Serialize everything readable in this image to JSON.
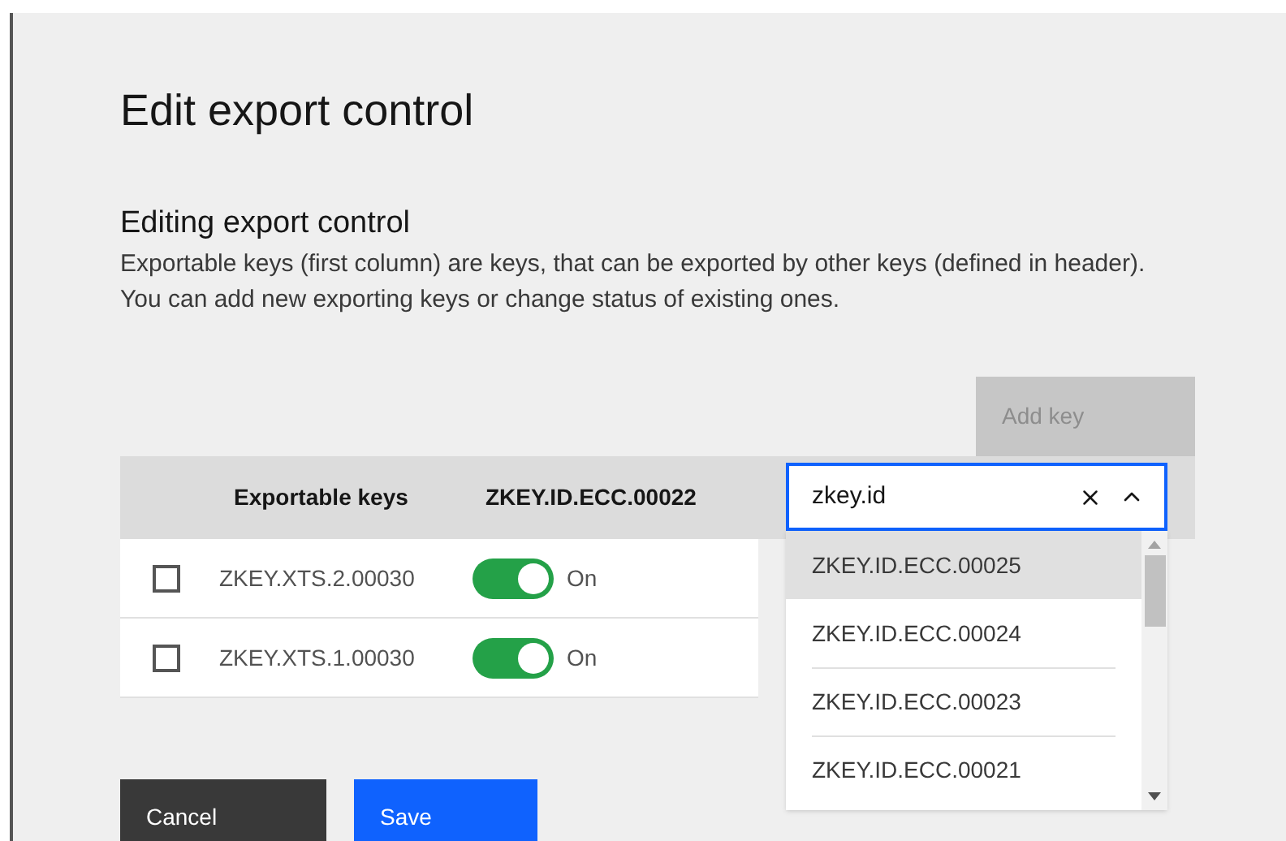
{
  "title": "Edit export control",
  "section": {
    "heading": "Editing export control",
    "description": "Exportable keys (first column) are keys, that can be exported by other keys (defined in header). You can add new exporting keys or change status of existing ones."
  },
  "add_key_button": {
    "label": "Add key",
    "disabled": true
  },
  "table": {
    "columns": [
      "Exportable keys",
      "ZKEY.ID.ECC.00022"
    ],
    "rows": [
      {
        "checked": false,
        "key": "ZKEY.XTS.2.00030",
        "on": true,
        "status": "On"
      },
      {
        "checked": false,
        "key": "ZKEY.XTS.1.00030",
        "on": true,
        "status": "On"
      }
    ]
  },
  "key_combobox": {
    "value": "zkey.id",
    "expanded": true,
    "options": [
      {
        "label": "ZKEY.ID.ECC.00025",
        "selected": true
      },
      {
        "label": "ZKEY.ID.ECC.00024",
        "selected": false
      },
      {
        "label": "ZKEY.ID.ECC.00023",
        "selected": false
      },
      {
        "label": "ZKEY.ID.ECC.00021",
        "selected": false
      }
    ]
  },
  "buttons": [
    {
      "label": "Cancel",
      "kind": "secondary"
    },
    {
      "label": "Save",
      "kind": "primary"
    }
  ]
}
